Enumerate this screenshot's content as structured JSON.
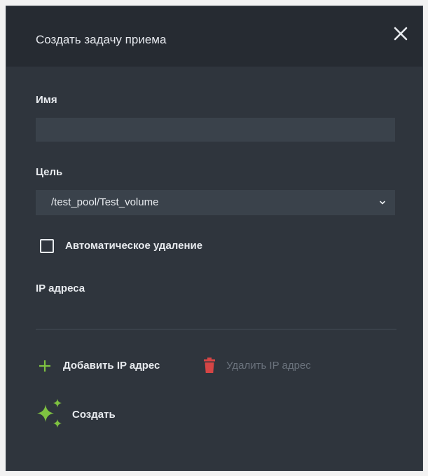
{
  "dialog": {
    "title": "Создать задачу приема",
    "close_icon": "close-icon"
  },
  "form": {
    "name_label": "Имя",
    "name_value": "",
    "target_label": "Цель",
    "target_value": "/test_pool/Test_volume",
    "auto_delete_label": "Автоматическое удаление",
    "auto_delete_checked": false,
    "ip_label": "IP адреса"
  },
  "actions": {
    "add_ip_label": "Добавить IP адрес",
    "delete_ip_label": "Удалить IP адрес",
    "create_label": "Создать"
  },
  "colors": {
    "accent_green": "#7fc241",
    "danger_red": "#d64545",
    "panel_bg": "#2f353d",
    "header_bg": "#262b32",
    "input_bg": "#3a424b"
  }
}
